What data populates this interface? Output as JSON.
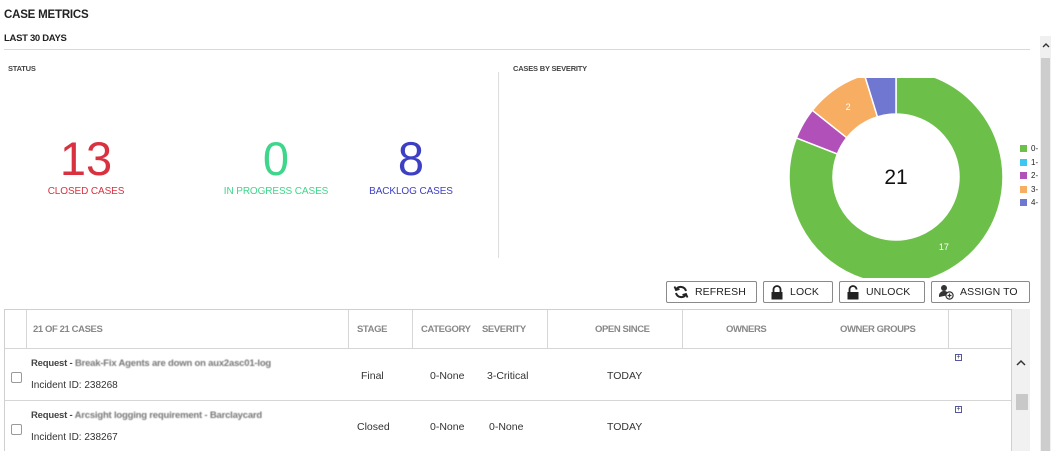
{
  "header": {
    "title": "CASE METRICS",
    "period": "LAST 30 DAYS"
  },
  "status": {
    "label": "STATUS",
    "metrics": [
      {
        "value": "13",
        "label": "CLOSED CASES",
        "color": "#d9313f"
      },
      {
        "value": "0",
        "label": "IN PROGRESS CASES",
        "color": "#3ed68a"
      },
      {
        "value": "8",
        "label": "BACKLOG CASES",
        "color": "#3d3fc4"
      }
    ]
  },
  "severity": {
    "label": "CASES BY SEVERITY",
    "total": "21",
    "legend": [
      "0-",
      "1-",
      "2-",
      "3-",
      "4-"
    ]
  },
  "chart_data": {
    "type": "pie",
    "categories": [
      "0-",
      "1-",
      "2-",
      "3-",
      "4-"
    ],
    "values": [
      17,
      0,
      1,
      2,
      1
    ],
    "colors": [
      "#6cc04a",
      "#3cc6f0",
      "#b050b8",
      "#f8ae62",
      "#6f77d0"
    ],
    "data_labels": [
      "17",
      "",
      "",
      "2",
      ""
    ],
    "center_label": "21",
    "legend_placement": "right"
  },
  "toolbar": {
    "refresh": "REFRESH",
    "lock": "LOCK",
    "unlock": "UNLOCK",
    "assign": "ASSIGN TO"
  },
  "table": {
    "headers": {
      "count": "21 OF 21 CASES",
      "stage": "STAGE",
      "category": "CATEGORY",
      "severity": "SEVERITY",
      "open_since": "OPEN SINCE",
      "owners": "OWNERS",
      "owner_groups": "OWNER GROUPS"
    },
    "rows": [
      {
        "prefix": "Request - ",
        "title": "Break-Fix Agents are down on aux2asc01-log",
        "id": "Incident ID: 238268",
        "stage": "Final",
        "category": "0-None",
        "severity": "3-Critical",
        "open_since": "TODAY"
      },
      {
        "prefix": "Request - ",
        "title": "Arcsight logging requirement - Barclaycard",
        "id": "Incident ID: 238267",
        "stage": "Closed",
        "category": "0-None",
        "severity": "0-None",
        "open_since": "TODAY"
      }
    ]
  }
}
